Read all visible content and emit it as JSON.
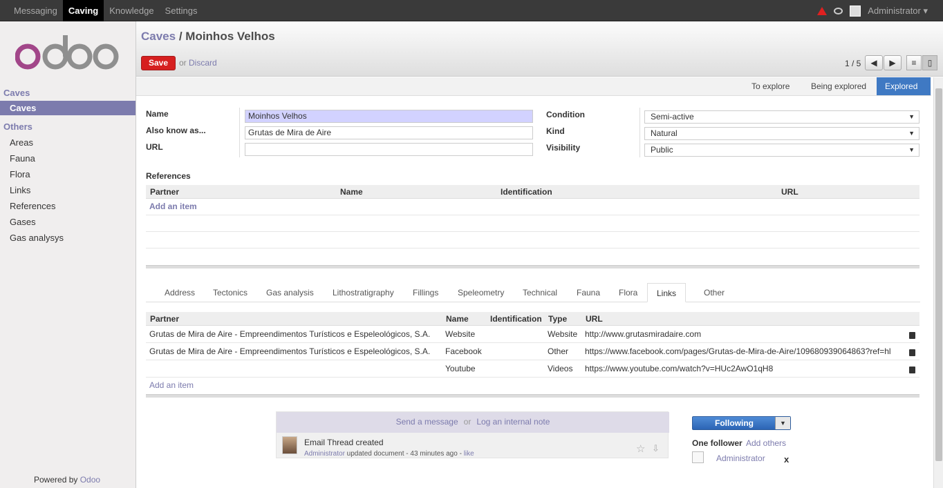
{
  "topbar": {
    "menu": [
      "Messaging",
      "Caving",
      "Knowledge",
      "Settings"
    ],
    "active_index": 1,
    "user": "Administrator ▾"
  },
  "sidebar": {
    "logo_text": "odoo",
    "section1": "Caves",
    "section1_items": [
      "Caves"
    ],
    "section2": "Others",
    "section2_items": [
      "Areas",
      "Fauna",
      "Flora",
      "Links",
      "References",
      "Gases",
      "Gas analysys"
    ],
    "powered_by": "Powered by",
    "powered_brand": "Odoo"
  },
  "header": {
    "breadcrumb_parent": "Caves",
    "breadcrumb_sep": " / ",
    "breadcrumb_current": "Moinhos Velhos",
    "save_label": "Save",
    "or_label": "or",
    "discard_label": "Discard",
    "pager": "1 / 5",
    "prev_label": "◀",
    "next_label": "▶",
    "list_view_label": "≡",
    "form_view_label": "▯"
  },
  "status": {
    "stages": [
      "To explore",
      "Being explored",
      "Explored"
    ],
    "active_stage": "Explored"
  },
  "form": {
    "name_label": "Name",
    "name_value": "Moinhos Velhos",
    "aka_label": "Also know as...",
    "aka_value": "Grutas de Mira de Aire",
    "url_label": "URL",
    "url_value": "",
    "condition_label": "Condition",
    "condition_value": "Semi-active",
    "kind_label": "Kind",
    "kind_value": "Natural",
    "visibility_label": "Visibility",
    "visibility_value": "Public"
  },
  "references": {
    "title": "References",
    "columns": [
      "Partner",
      "Name",
      "Identification",
      "URL"
    ],
    "add_item": "Add an item"
  },
  "tabs": {
    "items": [
      "Address",
      "Tectonics",
      "Gas analysis",
      "Lithostratigraphy",
      "Fillings",
      "Speleometry",
      "Technical",
      "Fauna",
      "Flora",
      "Links",
      "Other"
    ],
    "active": "Links"
  },
  "links": {
    "columns": [
      "Partner",
      "Name",
      "Identification",
      "Type",
      "URL"
    ],
    "rows": [
      {
        "partner": "Grutas de Mira de Aire - Empreendimentos Turísticos e Espeleológicos, S.A.",
        "name": "Website",
        "identification": "",
        "type": "Website",
        "url": "http://www.grutasmiradaire.com"
      },
      {
        "partner": "Grutas de Mira de Aire - Empreendimentos Turísticos e Espeleológicos, S.A.",
        "name": "Facebook",
        "identification": "",
        "type": "Other",
        "url": "https://www.facebook.com/pages/Grutas-de-Mira-de-Aire/109680939064863?ref=hl"
      },
      {
        "partner": "",
        "name": "Youtube",
        "identification": "",
        "type": "Videos",
        "url": "https://www.youtube.com/watch?v=HUc2AwO1qH8"
      }
    ],
    "add_item": "Add an item"
  },
  "chatter": {
    "send_message": "Send a message",
    "or_label": "or",
    "log_note": "Log an internal note",
    "message_title": "Email Thread created",
    "message_author": "Administrator",
    "message_action": " updated document - 43 minutes ago - ",
    "message_like": "like",
    "following_label": "Following",
    "followers_count": "One follower",
    "add_others": "Add others",
    "follower_name": "Administrator",
    "remove_label": "x"
  }
}
